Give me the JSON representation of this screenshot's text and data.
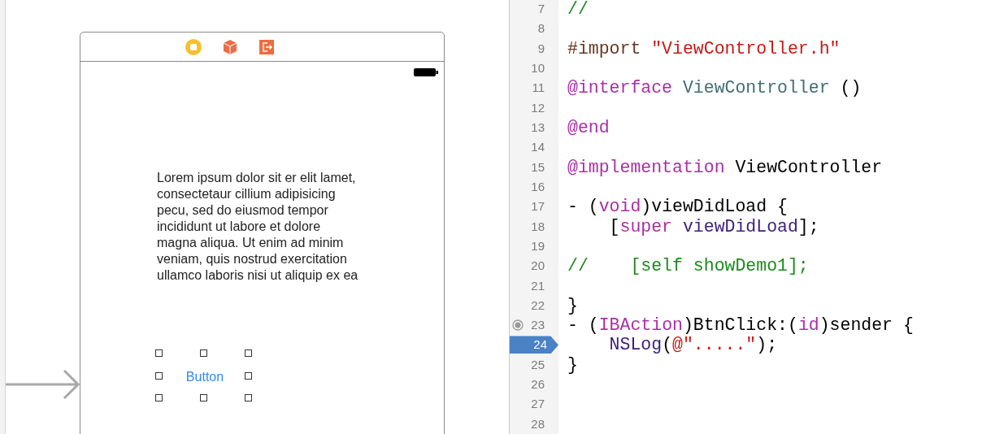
{
  "storyboard": {
    "label": {
      "lines": [
        "Lorem ipsum dolor sit er elit lamet,",
        "consectetaur cillium adipisicing",
        "pecu, sed do eiusmod tempor",
        "incididunt ut labore et dolore",
        "magna aliqua. Ut enim ad minim",
        "veniam, quis nostrud exercitation",
        "ullamco laboris nisi ut aliquip ex ea"
      ]
    },
    "button": {
      "label": "Button",
      "selected": true
    }
  },
  "code_editor": {
    "lines": [
      {
        "number": "7",
        "current": false,
        "connected": false,
        "tokens": [
          {
            "text": "//",
            "kind": "comment"
          }
        ]
      },
      {
        "number": "8",
        "current": false,
        "connected": false
      },
      {
        "number": "9",
        "current": false,
        "connected": false,
        "tokens": [
          {
            "text": "#import ",
            "kind": "directive"
          },
          {
            "text": "\"ViewController.h\"",
            "kind": "string"
          }
        ]
      },
      {
        "number": "10",
        "current": false,
        "connected": false
      },
      {
        "number": "11",
        "current": false,
        "connected": false,
        "tokens": [
          {
            "text": "@interface",
            "kind": "keyword"
          },
          {
            "text": " ViewController",
            "kind": "class"
          },
          {
            "text": " ()",
            "kind": "plain"
          }
        ]
      },
      {
        "number": "12",
        "current": false,
        "connected": false
      },
      {
        "number": "13",
        "current": false,
        "connected": false,
        "tokens": [
          {
            "text": "@end",
            "kind": "keyword"
          }
        ]
      },
      {
        "number": "14",
        "current": false,
        "connected": false
      },
      {
        "number": "15",
        "current": false,
        "connected": false,
        "tokens": [
          {
            "text": "@implementation",
            "kind": "keyword"
          },
          {
            "text": " ViewController",
            "kind": "plain"
          }
        ]
      },
      {
        "number": "16",
        "current": false,
        "connected": false
      },
      {
        "number": "17",
        "current": false,
        "connected": false,
        "tokens": [
          {
            "text": "- (",
            "kind": "plain"
          },
          {
            "text": "void",
            "kind": "keyword"
          },
          {
            "text": ")viewDidLoad {",
            "kind": "plain"
          }
        ]
      },
      {
        "number": "18",
        "current": false,
        "connected": false,
        "tokens": [
          {
            "text": "    [",
            "kind": "plain"
          },
          {
            "text": "super",
            "kind": "keyword"
          },
          {
            "text": " viewDidLoad",
            "kind": "method"
          },
          {
            "text": "];",
            "kind": "plain"
          }
        ]
      },
      {
        "number": "19",
        "current": false,
        "connected": false
      },
      {
        "number": "20",
        "current": false,
        "connected": false,
        "tokens": [
          {
            "text": "//    [self showDemo1];",
            "kind": "comment"
          }
        ]
      },
      {
        "number": "21",
        "current": false,
        "connected": false
      },
      {
        "number": "22",
        "current": false,
        "connected": false,
        "tokens": [
          {
            "text": "}",
            "kind": "plain"
          }
        ]
      },
      {
        "number": "23",
        "current": false,
        "connected": true,
        "tokens": [
          {
            "text": "- (",
            "kind": "plain"
          },
          {
            "text": "IBAction",
            "kind": "keyword"
          },
          {
            "text": ")BtnClick:(",
            "kind": "plain"
          },
          {
            "text": "id",
            "kind": "keyword"
          },
          {
            "text": ")sender {",
            "kind": "plain"
          }
        ]
      },
      {
        "number": "24",
        "current": true,
        "connected": false,
        "tokens": [
          {
            "text": "    NSLog",
            "kind": "method"
          },
          {
            "text": "(",
            "kind": "plain"
          },
          {
            "text": "@\".....\"",
            "kind": "string"
          },
          {
            "text": ");",
            "kind": "plain"
          }
        ]
      },
      {
        "number": "25",
        "current": false,
        "connected": false,
        "tokens": [
          {
            "text": "}",
            "kind": "plain"
          }
        ]
      },
      {
        "number": "26",
        "current": false,
        "connected": false
      },
      {
        "number": "27",
        "current": false,
        "connected": false
      },
      {
        "number": "28",
        "current": false,
        "connected": false
      }
    ]
  }
}
